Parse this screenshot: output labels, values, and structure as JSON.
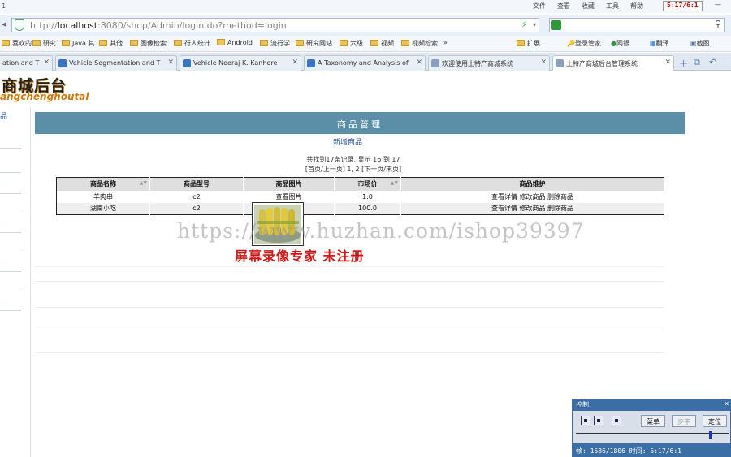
{
  "browser": {
    "corner_title": "1",
    "menus": [
      "文件",
      "查看",
      "收藏",
      "工具",
      "帮助"
    ],
    "recorder_badge": "5:17/6:1",
    "address": {
      "prefix": "http://",
      "host": "localhost",
      "rest": ":8080/shop/Admin/login.do?method=login"
    },
    "bookmarks": [
      "喜欢的",
      "研究",
      "Java 其",
      "其他",
      "图像检索",
      "行人统计",
      "Android",
      "流行学",
      "研究网站",
      "六级",
      "视频",
      "视频检索",
      "»",
      "扩展",
      "登录管家",
      "网银",
      "翻译",
      "截图"
    ],
    "tabs": [
      {
        "label": "ation and T",
        "active": false
      },
      {
        "label": "Vehicle Segmentation and T",
        "active": false
      },
      {
        "label": "Vehicle Neeraj K. Kanhere",
        "active": false
      },
      {
        "label": "A Taxonomy and Analysis of",
        "active": false
      },
      {
        "label": "欢迎使用土特产商城系统",
        "active": false
      },
      {
        "label": "土特产商城后台管理系统",
        "active": true
      }
    ]
  },
  "page": {
    "logo_title": "商城后台",
    "logo_subtitle": "angchenghoutal",
    "sidebar_link": "品",
    "header": "商品管理",
    "add_link": "新增商品",
    "summary": "共找到17条记录, 显示 16 到 17",
    "pager": "[首页/上一页] 1, 2 [下一页/末页]",
    "table": {
      "headers": [
        "商品名称",
        "商品型号",
        "商品图片",
        "市场价",
        "商品维护"
      ],
      "rows": [
        {
          "name": "羊肉串",
          "model": "c2",
          "image_link": "查看图片",
          "price": "1.0",
          "actions": "查看详情 修改商品 删除商品"
        },
        {
          "name": "湖南小吃",
          "model": "c2",
          "image_link": "",
          "price": "100.0",
          "actions": "查看详情 修改商品 删除商品"
        }
      ]
    }
  },
  "overlay": {
    "watermark_url": "https://www.huzhan.com/ishop39397",
    "watermark_text": "屏幕录像专家 未注册"
  },
  "recorder": {
    "title": "控制",
    "buttons": [
      "菜单",
      "定位"
    ],
    "disabled_button": "步字",
    "status": "帧: 1586/1806 时间: 5:17/6:1"
  }
}
